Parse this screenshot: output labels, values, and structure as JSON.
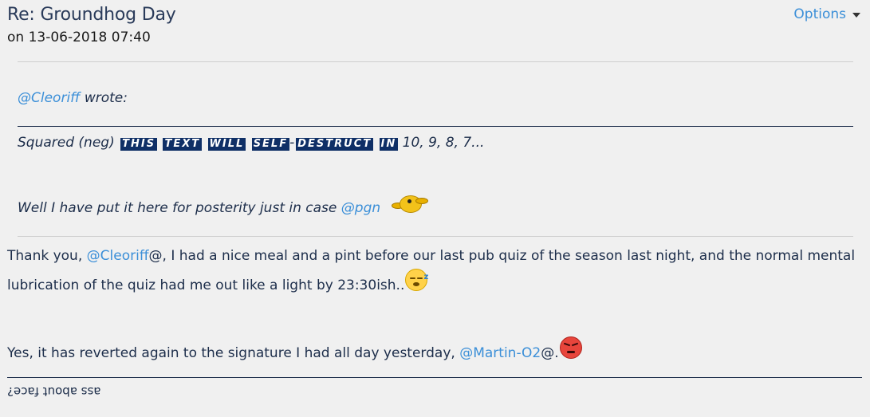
{
  "post": {
    "title": "Re: Groundhog Day",
    "date": "on 13-06-2018 07:40",
    "options_label": "Options"
  },
  "quote": {
    "author_mention": "@Cleoriff",
    "wrote_label": " wrote:",
    "squared_prefix": "Squared (neg) ",
    "squared_words": [
      "THIS",
      "TEXT",
      "WILL",
      "SELF",
      "DESTRUCT",
      "IN"
    ],
    "squared_suffix": " 10, 9, 8, 7...",
    "posterity_text": "Well I have put it here for posterity just in case ",
    "posterity_mention": "@pgn",
    "bird_icon": "bird-emoji-icon"
  },
  "body": {
    "p1_before": "Thank you, ",
    "p1_mention": "@Cleoriff",
    "p1_after": "@, I had a nice meal and a pint before our last pub quiz of the season last night, and the normal mental lubrication of the quiz had me out like a light by 23:30ish..",
    "p1_emoji": "sleepy-face-icon",
    "p2_before": "Yes, it has reverted again to the signature I had all day yesterday, ",
    "p2_mention": "@Martin-O2",
    "p2_after": "@.",
    "p2_emoji": "angry-face-icon"
  },
  "signature": {
    "text": "ass about face?"
  }
}
